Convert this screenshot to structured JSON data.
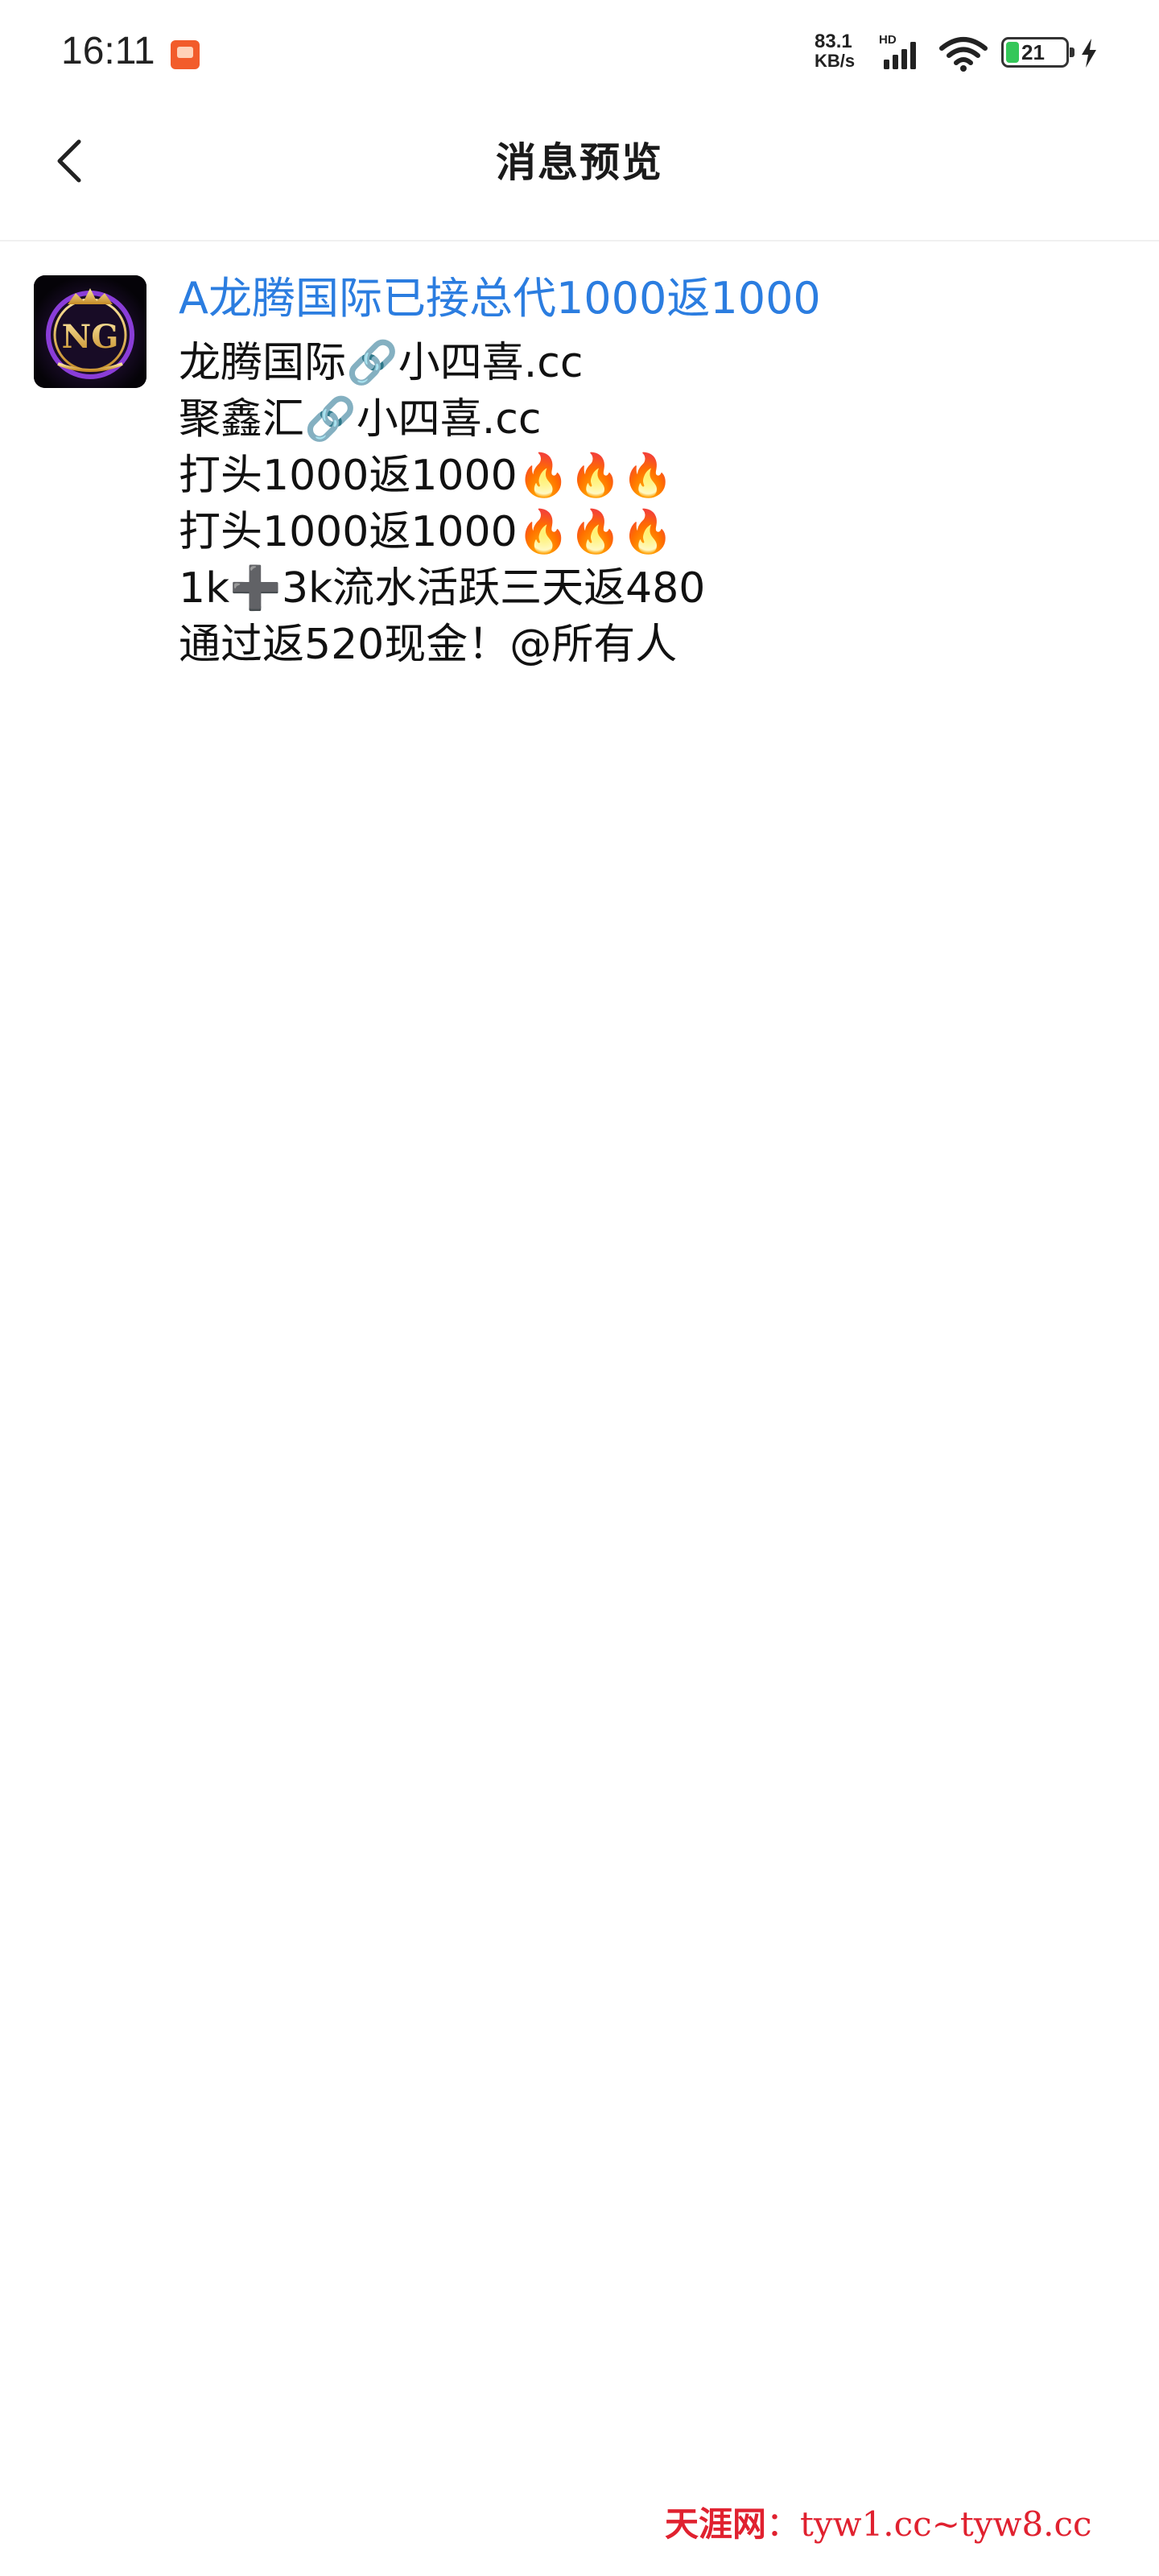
{
  "status_bar": {
    "time": "16:11",
    "network_speed_value": "83.1",
    "network_speed_unit": "KB/s",
    "network_type": "HD",
    "battery_level": "21",
    "icons": [
      "app-notification-icon",
      "signal-icon",
      "wifi-icon",
      "battery-icon",
      "charging-icon"
    ]
  },
  "header": {
    "title": "消息预览",
    "back_icon": "chevron-left-icon"
  },
  "message": {
    "avatar_text": "NG",
    "title": "A龙腾国际已接总代1000返1000",
    "lines": [
      "龙腾国际🔗小四喜.cc",
      "聚鑫汇🔗小四喜.cc",
      "打头1000返1000🔥🔥🔥",
      "打头1000返1000🔥🔥🔥",
      "1k➕3k流水活跃三天返480",
      "通过返520现金！@所有人"
    ]
  },
  "watermark": {
    "brand": "天涯网",
    "separator": "：",
    "urls": "tyw1.cc~tyw8.cc"
  },
  "colors": {
    "title_blue": "#2b7de0",
    "watermark_red": "#e0212f",
    "battery_green": "#34c759"
  }
}
